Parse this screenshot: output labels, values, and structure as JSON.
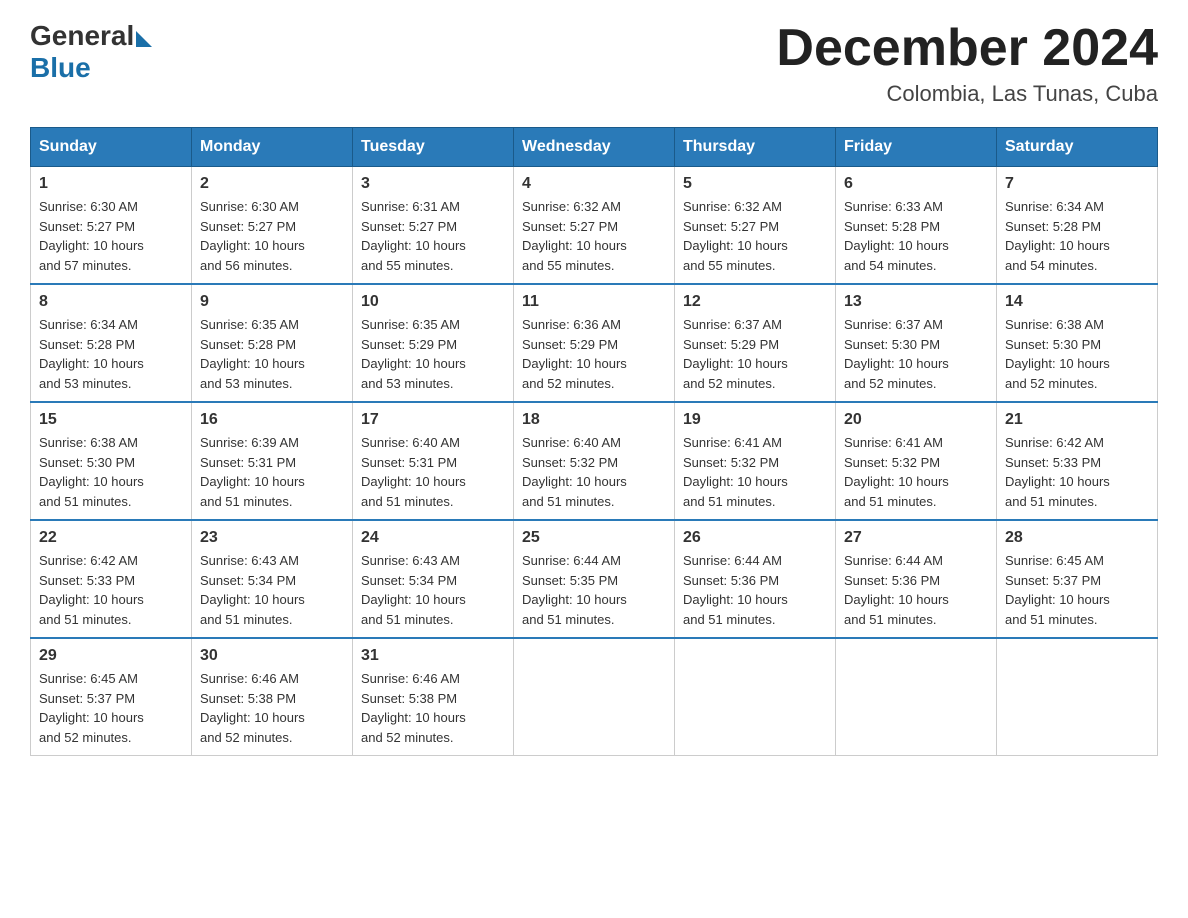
{
  "logo": {
    "general": "General",
    "blue": "Blue"
  },
  "title": "December 2024",
  "subtitle": "Colombia, Las Tunas, Cuba",
  "days": [
    "Sunday",
    "Monday",
    "Tuesday",
    "Wednesday",
    "Thursday",
    "Friday",
    "Saturday"
  ],
  "weeks": [
    [
      {
        "day": "1",
        "sunrise": "6:30 AM",
        "sunset": "5:27 PM",
        "daylight": "10 hours and 57 minutes."
      },
      {
        "day": "2",
        "sunrise": "6:30 AM",
        "sunset": "5:27 PM",
        "daylight": "10 hours and 56 minutes."
      },
      {
        "day": "3",
        "sunrise": "6:31 AM",
        "sunset": "5:27 PM",
        "daylight": "10 hours and 55 minutes."
      },
      {
        "day": "4",
        "sunrise": "6:32 AM",
        "sunset": "5:27 PM",
        "daylight": "10 hours and 55 minutes."
      },
      {
        "day": "5",
        "sunrise": "6:32 AM",
        "sunset": "5:27 PM",
        "daylight": "10 hours and 55 minutes."
      },
      {
        "day": "6",
        "sunrise": "6:33 AM",
        "sunset": "5:28 PM",
        "daylight": "10 hours and 54 minutes."
      },
      {
        "day": "7",
        "sunrise": "6:34 AM",
        "sunset": "5:28 PM",
        "daylight": "10 hours and 54 minutes."
      }
    ],
    [
      {
        "day": "8",
        "sunrise": "6:34 AM",
        "sunset": "5:28 PM",
        "daylight": "10 hours and 53 minutes."
      },
      {
        "day": "9",
        "sunrise": "6:35 AM",
        "sunset": "5:28 PM",
        "daylight": "10 hours and 53 minutes."
      },
      {
        "day": "10",
        "sunrise": "6:35 AM",
        "sunset": "5:29 PM",
        "daylight": "10 hours and 53 minutes."
      },
      {
        "day": "11",
        "sunrise": "6:36 AM",
        "sunset": "5:29 PM",
        "daylight": "10 hours and 52 minutes."
      },
      {
        "day": "12",
        "sunrise": "6:37 AM",
        "sunset": "5:29 PM",
        "daylight": "10 hours and 52 minutes."
      },
      {
        "day": "13",
        "sunrise": "6:37 AM",
        "sunset": "5:30 PM",
        "daylight": "10 hours and 52 minutes."
      },
      {
        "day": "14",
        "sunrise": "6:38 AM",
        "sunset": "5:30 PM",
        "daylight": "10 hours and 52 minutes."
      }
    ],
    [
      {
        "day": "15",
        "sunrise": "6:38 AM",
        "sunset": "5:30 PM",
        "daylight": "10 hours and 51 minutes."
      },
      {
        "day": "16",
        "sunrise": "6:39 AM",
        "sunset": "5:31 PM",
        "daylight": "10 hours and 51 minutes."
      },
      {
        "day": "17",
        "sunrise": "6:40 AM",
        "sunset": "5:31 PM",
        "daylight": "10 hours and 51 minutes."
      },
      {
        "day": "18",
        "sunrise": "6:40 AM",
        "sunset": "5:32 PM",
        "daylight": "10 hours and 51 minutes."
      },
      {
        "day": "19",
        "sunrise": "6:41 AM",
        "sunset": "5:32 PM",
        "daylight": "10 hours and 51 minutes."
      },
      {
        "day": "20",
        "sunrise": "6:41 AM",
        "sunset": "5:32 PM",
        "daylight": "10 hours and 51 minutes."
      },
      {
        "day": "21",
        "sunrise": "6:42 AM",
        "sunset": "5:33 PM",
        "daylight": "10 hours and 51 minutes."
      }
    ],
    [
      {
        "day": "22",
        "sunrise": "6:42 AM",
        "sunset": "5:33 PM",
        "daylight": "10 hours and 51 minutes."
      },
      {
        "day": "23",
        "sunrise": "6:43 AM",
        "sunset": "5:34 PM",
        "daylight": "10 hours and 51 minutes."
      },
      {
        "day": "24",
        "sunrise": "6:43 AM",
        "sunset": "5:34 PM",
        "daylight": "10 hours and 51 minutes."
      },
      {
        "day": "25",
        "sunrise": "6:44 AM",
        "sunset": "5:35 PM",
        "daylight": "10 hours and 51 minutes."
      },
      {
        "day": "26",
        "sunrise": "6:44 AM",
        "sunset": "5:36 PM",
        "daylight": "10 hours and 51 minutes."
      },
      {
        "day": "27",
        "sunrise": "6:44 AM",
        "sunset": "5:36 PM",
        "daylight": "10 hours and 51 minutes."
      },
      {
        "day": "28",
        "sunrise": "6:45 AM",
        "sunset": "5:37 PM",
        "daylight": "10 hours and 51 minutes."
      }
    ],
    [
      {
        "day": "29",
        "sunrise": "6:45 AM",
        "sunset": "5:37 PM",
        "daylight": "10 hours and 52 minutes."
      },
      {
        "day": "30",
        "sunrise": "6:46 AM",
        "sunset": "5:38 PM",
        "daylight": "10 hours and 52 minutes."
      },
      {
        "day": "31",
        "sunrise": "6:46 AM",
        "sunset": "5:38 PM",
        "daylight": "10 hours and 52 minutes."
      },
      null,
      null,
      null,
      null
    ]
  ],
  "labels": {
    "sunrise": "Sunrise:",
    "sunset": "Sunset:",
    "daylight": "Daylight:"
  }
}
